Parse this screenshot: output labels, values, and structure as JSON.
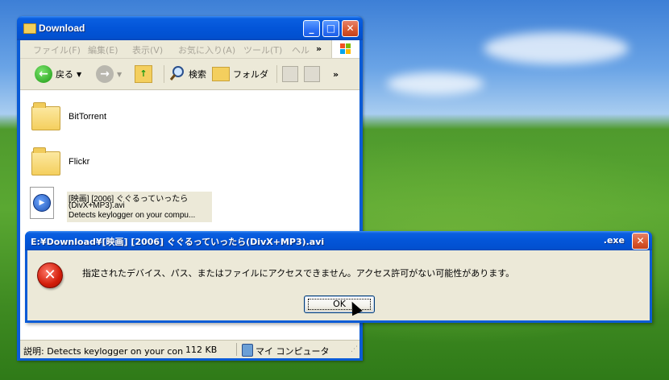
{
  "explorer": {
    "title": "Download",
    "menu": [
      "ファイル(F)",
      "編集(E)",
      "表示(V)",
      "お気に入り(A)",
      "ツール(T)",
      "ヘル"
    ],
    "menu_more": "»",
    "toolbar": {
      "back": "戻る",
      "search": "検索",
      "folders": "フォルダ",
      "more": "»"
    },
    "items": [
      {
        "name": "BitTorrent"
      },
      {
        "name": "Flickr"
      },
      {
        "name_line1": "[映画] [2006] ぐぐるっていったら",
        "name_line2": "(DivX+MP3).avi",
        "desc": "Detects keylogger on your compu..."
      }
    ],
    "status": {
      "description": "説明: Detects keylogger on your con",
      "size": "112 KB",
      "zone": "マイ コンピュータ"
    }
  },
  "dialog": {
    "title": "E:¥Download¥[映画] [2006] ぐぐるっていったら(DivX+MP3).avi",
    "title_ext": ".exe",
    "message": "指定されたデバイス、パス、またはファイルにアクセスできません。アクセス許可がない可能性があります。",
    "ok_label": "OK"
  },
  "colors": {
    "xp_blue": "#0355d8",
    "dialog_bg": "#ece9d8",
    "error_red": "#d21d0a"
  }
}
